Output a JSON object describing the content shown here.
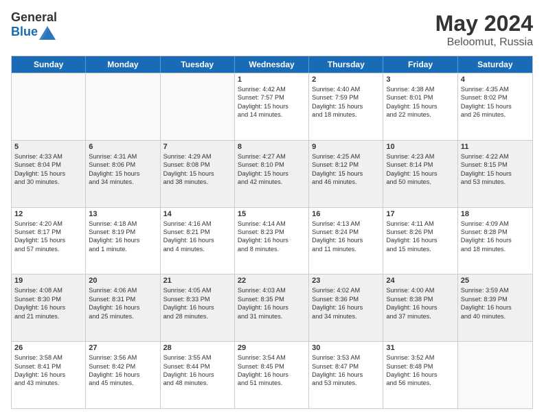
{
  "logo": {
    "general": "General",
    "blue": "Blue"
  },
  "header": {
    "month_year": "May 2024",
    "location": "Beloomut, Russia"
  },
  "days_of_week": [
    "Sunday",
    "Monday",
    "Tuesday",
    "Wednesday",
    "Thursday",
    "Friday",
    "Saturday"
  ],
  "weeks": [
    [
      {
        "day": "",
        "empty": true,
        "lines": []
      },
      {
        "day": "",
        "empty": true,
        "lines": []
      },
      {
        "day": "",
        "empty": true,
        "lines": []
      },
      {
        "day": "1",
        "empty": false,
        "lines": [
          "Sunrise: 4:42 AM",
          "Sunset: 7:57 PM",
          "Daylight: 15 hours",
          "and 14 minutes."
        ]
      },
      {
        "day": "2",
        "empty": false,
        "lines": [
          "Sunrise: 4:40 AM",
          "Sunset: 7:59 PM",
          "Daylight: 15 hours",
          "and 18 minutes."
        ]
      },
      {
        "day": "3",
        "empty": false,
        "lines": [
          "Sunrise: 4:38 AM",
          "Sunset: 8:01 PM",
          "Daylight: 15 hours",
          "and 22 minutes."
        ]
      },
      {
        "day": "4",
        "empty": false,
        "lines": [
          "Sunrise: 4:35 AM",
          "Sunset: 8:02 PM",
          "Daylight: 15 hours",
          "and 26 minutes."
        ]
      }
    ],
    [
      {
        "day": "5",
        "empty": false,
        "lines": [
          "Sunrise: 4:33 AM",
          "Sunset: 8:04 PM",
          "Daylight: 15 hours",
          "and 30 minutes."
        ]
      },
      {
        "day": "6",
        "empty": false,
        "lines": [
          "Sunrise: 4:31 AM",
          "Sunset: 8:06 PM",
          "Daylight: 15 hours",
          "and 34 minutes."
        ]
      },
      {
        "day": "7",
        "empty": false,
        "lines": [
          "Sunrise: 4:29 AM",
          "Sunset: 8:08 PM",
          "Daylight: 15 hours",
          "and 38 minutes."
        ]
      },
      {
        "day": "8",
        "empty": false,
        "lines": [
          "Sunrise: 4:27 AM",
          "Sunset: 8:10 PM",
          "Daylight: 15 hours",
          "and 42 minutes."
        ]
      },
      {
        "day": "9",
        "empty": false,
        "lines": [
          "Sunrise: 4:25 AM",
          "Sunset: 8:12 PM",
          "Daylight: 15 hours",
          "and 46 minutes."
        ]
      },
      {
        "day": "10",
        "empty": false,
        "lines": [
          "Sunrise: 4:23 AM",
          "Sunset: 8:14 PM",
          "Daylight: 15 hours",
          "and 50 minutes."
        ]
      },
      {
        "day": "11",
        "empty": false,
        "lines": [
          "Sunrise: 4:22 AM",
          "Sunset: 8:15 PM",
          "Daylight: 15 hours",
          "and 53 minutes."
        ]
      }
    ],
    [
      {
        "day": "12",
        "empty": false,
        "lines": [
          "Sunrise: 4:20 AM",
          "Sunset: 8:17 PM",
          "Daylight: 15 hours",
          "and 57 minutes."
        ]
      },
      {
        "day": "13",
        "empty": false,
        "lines": [
          "Sunrise: 4:18 AM",
          "Sunset: 8:19 PM",
          "Daylight: 16 hours",
          "and 1 minute."
        ]
      },
      {
        "day": "14",
        "empty": false,
        "lines": [
          "Sunrise: 4:16 AM",
          "Sunset: 8:21 PM",
          "Daylight: 16 hours",
          "and 4 minutes."
        ]
      },
      {
        "day": "15",
        "empty": false,
        "lines": [
          "Sunrise: 4:14 AM",
          "Sunset: 8:23 PM",
          "Daylight: 16 hours",
          "and 8 minutes."
        ]
      },
      {
        "day": "16",
        "empty": false,
        "lines": [
          "Sunrise: 4:13 AM",
          "Sunset: 8:24 PM",
          "Daylight: 16 hours",
          "and 11 minutes."
        ]
      },
      {
        "day": "17",
        "empty": false,
        "lines": [
          "Sunrise: 4:11 AM",
          "Sunset: 8:26 PM",
          "Daylight: 16 hours",
          "and 15 minutes."
        ]
      },
      {
        "day": "18",
        "empty": false,
        "lines": [
          "Sunrise: 4:09 AM",
          "Sunset: 8:28 PM",
          "Daylight: 16 hours",
          "and 18 minutes."
        ]
      }
    ],
    [
      {
        "day": "19",
        "empty": false,
        "lines": [
          "Sunrise: 4:08 AM",
          "Sunset: 8:30 PM",
          "Daylight: 16 hours",
          "and 21 minutes."
        ]
      },
      {
        "day": "20",
        "empty": false,
        "lines": [
          "Sunrise: 4:06 AM",
          "Sunset: 8:31 PM",
          "Daylight: 16 hours",
          "and 25 minutes."
        ]
      },
      {
        "day": "21",
        "empty": false,
        "lines": [
          "Sunrise: 4:05 AM",
          "Sunset: 8:33 PM",
          "Daylight: 16 hours",
          "and 28 minutes."
        ]
      },
      {
        "day": "22",
        "empty": false,
        "lines": [
          "Sunrise: 4:03 AM",
          "Sunset: 8:35 PM",
          "Daylight: 16 hours",
          "and 31 minutes."
        ]
      },
      {
        "day": "23",
        "empty": false,
        "lines": [
          "Sunrise: 4:02 AM",
          "Sunset: 8:36 PM",
          "Daylight: 16 hours",
          "and 34 minutes."
        ]
      },
      {
        "day": "24",
        "empty": false,
        "lines": [
          "Sunrise: 4:00 AM",
          "Sunset: 8:38 PM",
          "Daylight: 16 hours",
          "and 37 minutes."
        ]
      },
      {
        "day": "25",
        "empty": false,
        "lines": [
          "Sunrise: 3:59 AM",
          "Sunset: 8:39 PM",
          "Daylight: 16 hours",
          "and 40 minutes."
        ]
      }
    ],
    [
      {
        "day": "26",
        "empty": false,
        "lines": [
          "Sunrise: 3:58 AM",
          "Sunset: 8:41 PM",
          "Daylight: 16 hours",
          "and 43 minutes."
        ]
      },
      {
        "day": "27",
        "empty": false,
        "lines": [
          "Sunrise: 3:56 AM",
          "Sunset: 8:42 PM",
          "Daylight: 16 hours",
          "and 45 minutes."
        ]
      },
      {
        "day": "28",
        "empty": false,
        "lines": [
          "Sunrise: 3:55 AM",
          "Sunset: 8:44 PM",
          "Daylight: 16 hours",
          "and 48 minutes."
        ]
      },
      {
        "day": "29",
        "empty": false,
        "lines": [
          "Sunrise: 3:54 AM",
          "Sunset: 8:45 PM",
          "Daylight: 16 hours",
          "and 51 minutes."
        ]
      },
      {
        "day": "30",
        "empty": false,
        "lines": [
          "Sunrise: 3:53 AM",
          "Sunset: 8:47 PM",
          "Daylight: 16 hours",
          "and 53 minutes."
        ]
      },
      {
        "day": "31",
        "empty": false,
        "lines": [
          "Sunrise: 3:52 AM",
          "Sunset: 8:48 PM",
          "Daylight: 16 hours",
          "and 56 minutes."
        ]
      },
      {
        "day": "",
        "empty": true,
        "lines": []
      }
    ]
  ]
}
